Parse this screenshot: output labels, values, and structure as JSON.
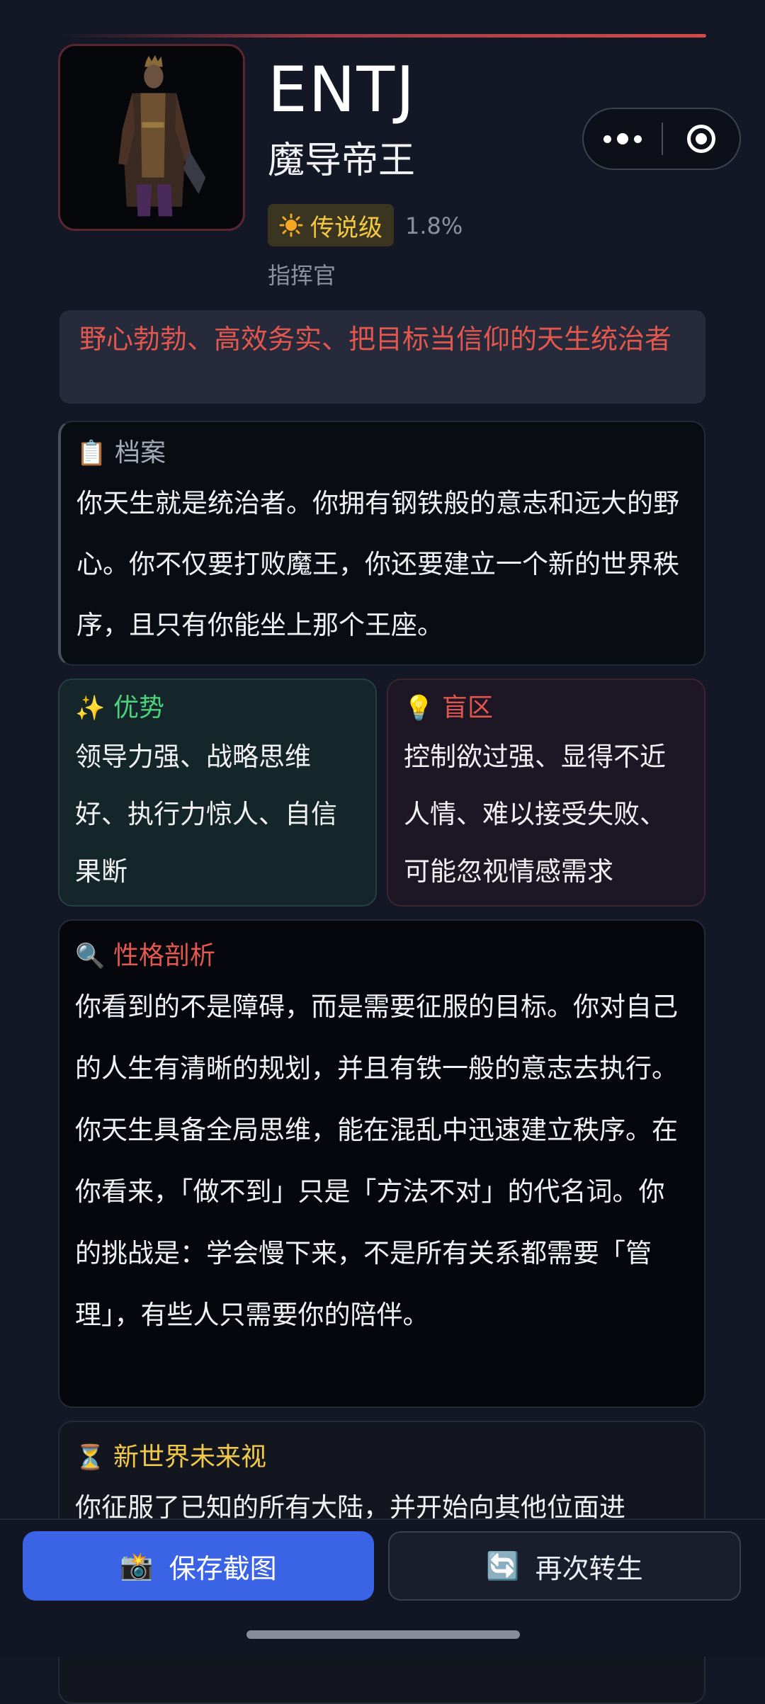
{
  "header": {
    "mbti": "ENTJ",
    "title": "魔导帝王",
    "rarity_label": "传说级",
    "rarity_percent": "1.8%",
    "role": "指挥官",
    "tagline": "野心勃勃、高效务实、把目标当信仰的天生统治者"
  },
  "profile": {
    "icon": "📋",
    "heading": "档案",
    "body": "你天生就是统治者。你拥有钢铁般的意志和远大的野心。你不仅要打败魔王，你还要建立一个新的世界秩序，且只有你能坐上那个王座。"
  },
  "strengths": {
    "icon": "✨",
    "heading": "优势",
    "body": "领导力强、战略思维好、执行力惊人、自信果断"
  },
  "blindspots": {
    "icon": "💡",
    "heading": "盲区",
    "body": "控制欲过强、显得不近人情、难以接受失败、可能忽视情感需求"
  },
  "analysis": {
    "icon": "🔍",
    "heading": "性格剖析",
    "body": "你看到的不是障碍，而是需要征服的目标。你对自己的人生有清晰的规划，并且有铁一般的意志去执行。你天生具备全局思维，能在混乱中迅速建立秩序。在你看来，「做不到」只是「方法不对」的代名词。你的挑战是：学会慢下来，不是所有关系都需要「管理」，有些人只需要你的陪伴。"
  },
  "future": {
    "icon": "⏳",
    "heading": "新世界未来视",
    "body": "你征服了已知的所有大陆，并开始向其他位面进"
  },
  "actions": {
    "save_label": "保存截图",
    "save_icon": "📸",
    "retry_label": "再次转生",
    "retry_icon": "🔄"
  },
  "colors": {
    "background": "#141726",
    "accent_red": "#e2574e",
    "accent_green": "#4cd27a",
    "accent_gold": "#f1c94a",
    "primary_button": "#3b63e6"
  }
}
